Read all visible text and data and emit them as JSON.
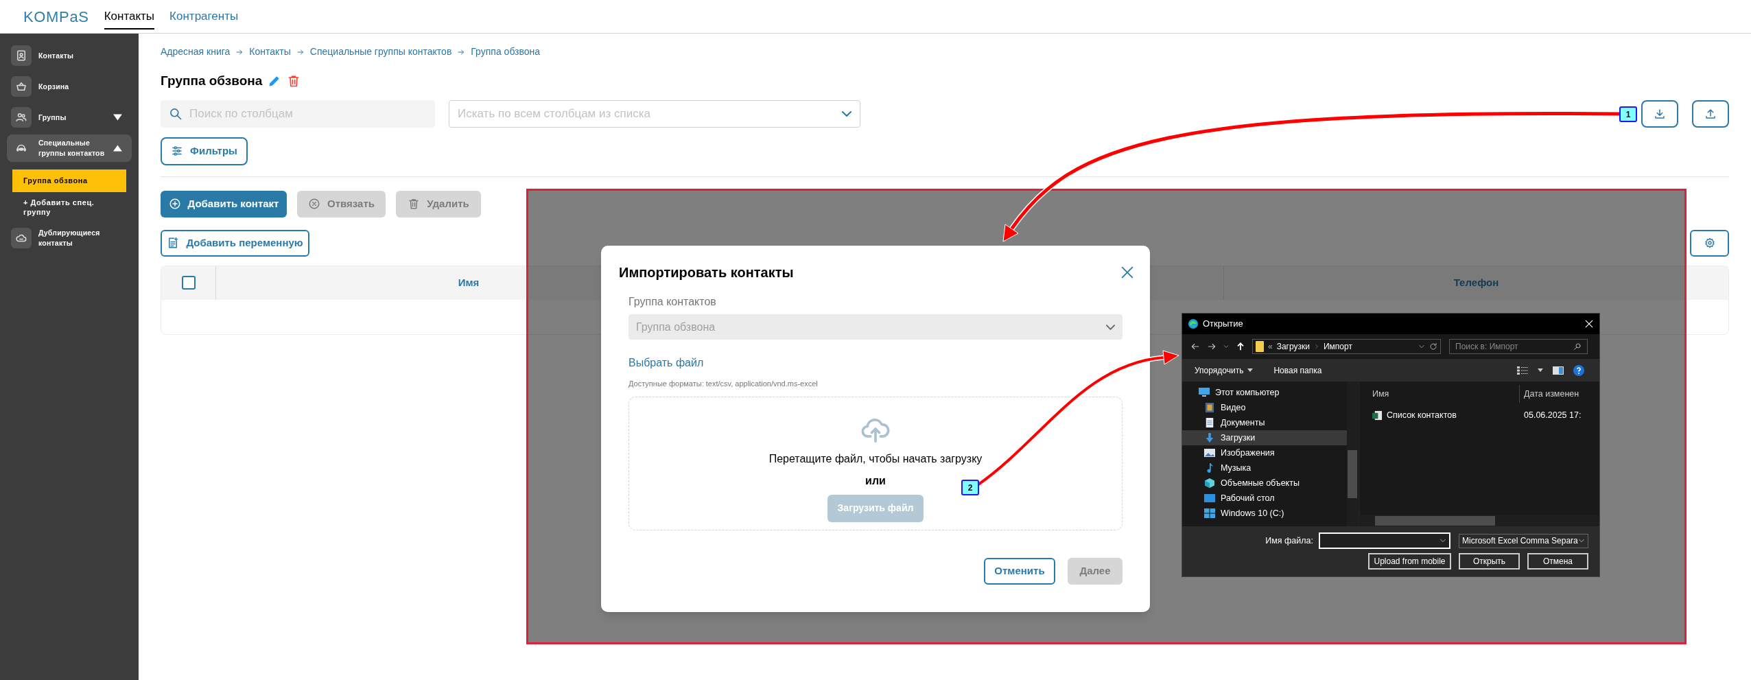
{
  "header": {
    "logo": "KOMPaS",
    "tabs": [
      {
        "label": "Контакты",
        "selected": true
      },
      {
        "label": "Контрагенты",
        "selected": false
      }
    ]
  },
  "sidebar": {
    "items": [
      {
        "label": "Контакты",
        "selected": false
      },
      {
        "label": "Корзина",
        "selected": false
      },
      {
        "label": "Группы",
        "selected": false,
        "expanded": false
      },
      {
        "label": "Специальные группы контактов",
        "selected": true,
        "expanded": true,
        "children": [
          {
            "label": "Группа обзвона",
            "kind": "group",
            "selected": true
          },
          {
            "label": "+ Добавить спец. группу",
            "kind": "add",
            "selected": false
          }
        ]
      },
      {
        "label": "Дублирующиеся контакты",
        "selected": false
      }
    ]
  },
  "breadcrumb": [
    "Адресная книга",
    "Контакты",
    "Специальные группы контактов",
    "Группа обзвона"
  ],
  "page_title": "Группа обзвона",
  "search": {
    "placeholder": "Поиск по столбцам"
  },
  "column_select": {
    "placeholder": "Искать по всем столбцам из списка"
  },
  "filters_button": "Фильтры",
  "actions": [
    {
      "label": "Добавить контакт",
      "disabled": false
    },
    {
      "label": "Отвязать",
      "disabled": true
    },
    {
      "label": "Удалить",
      "disabled": true
    }
  ],
  "add_variable_button": "Добавить переменную",
  "table": {
    "select_all": {
      "checked": false
    },
    "columns": [
      {
        "label": "Имя"
      },
      {
        "label": "Телефон"
      }
    ]
  },
  "import_dialog": {
    "title": "Импортировать контакты",
    "group_label": "Группа контактов",
    "group_value": "Группа обзвона",
    "choose_file": "Выбрать файл",
    "formats": "Доступные форматы: text/csv, application/vnd.ms-excel",
    "drop_text": "Перетащите файл, чтобы начать загрузку",
    "or": "или",
    "upload_button": {
      "label": "Загрузить файл",
      "disabled": true
    },
    "buttons": [
      {
        "label": "Отменить",
        "disabled": false
      },
      {
        "label": "Далее",
        "disabled": true
      }
    ]
  },
  "file_dialog": {
    "title": "Открытие",
    "path_overflow": "«",
    "path": [
      "Загрузки",
      "Импорт"
    ],
    "search_placeholder": "Поиск в: Импорт",
    "toolbar": [
      "Упорядочить",
      "Новая папка"
    ],
    "tree": [
      {
        "label": "Этот компьютер",
        "selected": false,
        "children": [
          {
            "label": "Видео",
            "selected": false
          },
          {
            "label": "Документы",
            "selected": false
          },
          {
            "label": "Загрузки",
            "selected": true
          },
          {
            "label": "Изображения",
            "selected": false
          },
          {
            "label": "Музыка",
            "selected": false
          },
          {
            "label": "Объемные объекты",
            "selected": false
          },
          {
            "label": "Рабочий стол",
            "selected": false
          },
          {
            "label": "Windows 10 (C:)",
            "selected": false
          }
        ]
      }
    ],
    "columns": [
      "Имя",
      "Дата изменен"
    ],
    "files": [
      {
        "name": "Список контактов",
        "date": "05.06.2025 17:"
      }
    ],
    "filename_label": "Имя файла:",
    "file_type": "Microsoft Excel Comma Separa",
    "buttons": [
      "Upload from mobile",
      "Открыть",
      "Отмена"
    ]
  },
  "annotations": [
    {
      "label": "1"
    },
    {
      "label": "2"
    }
  ]
}
